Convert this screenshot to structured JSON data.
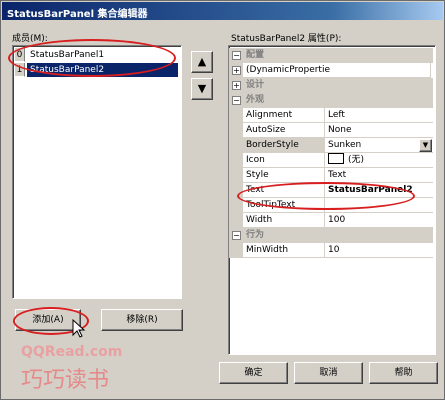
{
  "window": {
    "title": "StatusBarPanel 集合编辑器"
  },
  "members": {
    "label": "成员(M):",
    "items": [
      {
        "index": "0",
        "name": "StatusBarPanel1",
        "selected": false
      },
      {
        "index": "1",
        "name": "StatusBarPanel2",
        "selected": true
      }
    ],
    "move_up_icon": "up-arrow-icon",
    "move_down_icon": "down-arrow-icon"
  },
  "properties": {
    "label": "StatusBarPanel2 属性(P):",
    "categories": {
      "config": "配置",
      "design": "设计",
      "appearance": "外观",
      "behavior": "行为"
    },
    "dynamic": "(DynamicPropertie",
    "rows": {
      "alignment": {
        "name": "Alignment",
        "value": "Left"
      },
      "autosize": {
        "name": "AutoSize",
        "value": "None"
      },
      "borderstyle": {
        "name": "BorderStyle",
        "value": "Sunken"
      },
      "icon": {
        "name": "Icon",
        "value": "(无)"
      },
      "style": {
        "name": "Style",
        "value": "Text"
      },
      "text": {
        "name": "Text",
        "value": "StatusBarPanel2"
      },
      "tooltip": {
        "name": "ToolTipText",
        "value": ""
      },
      "width": {
        "name": "Width",
        "value": "100"
      },
      "minwidth": {
        "name": "MinWidth",
        "value": "10"
      }
    }
  },
  "buttons": {
    "add": "添加(A)",
    "remove": "移除(R)",
    "ok": "确定",
    "cancel": "取消",
    "help": "帮助"
  },
  "watermark": {
    "line1": "QQRead.com",
    "line2": "巧巧读书"
  },
  "colors": {
    "highlight": "#0a246a",
    "annotation": "#d81e1e"
  }
}
